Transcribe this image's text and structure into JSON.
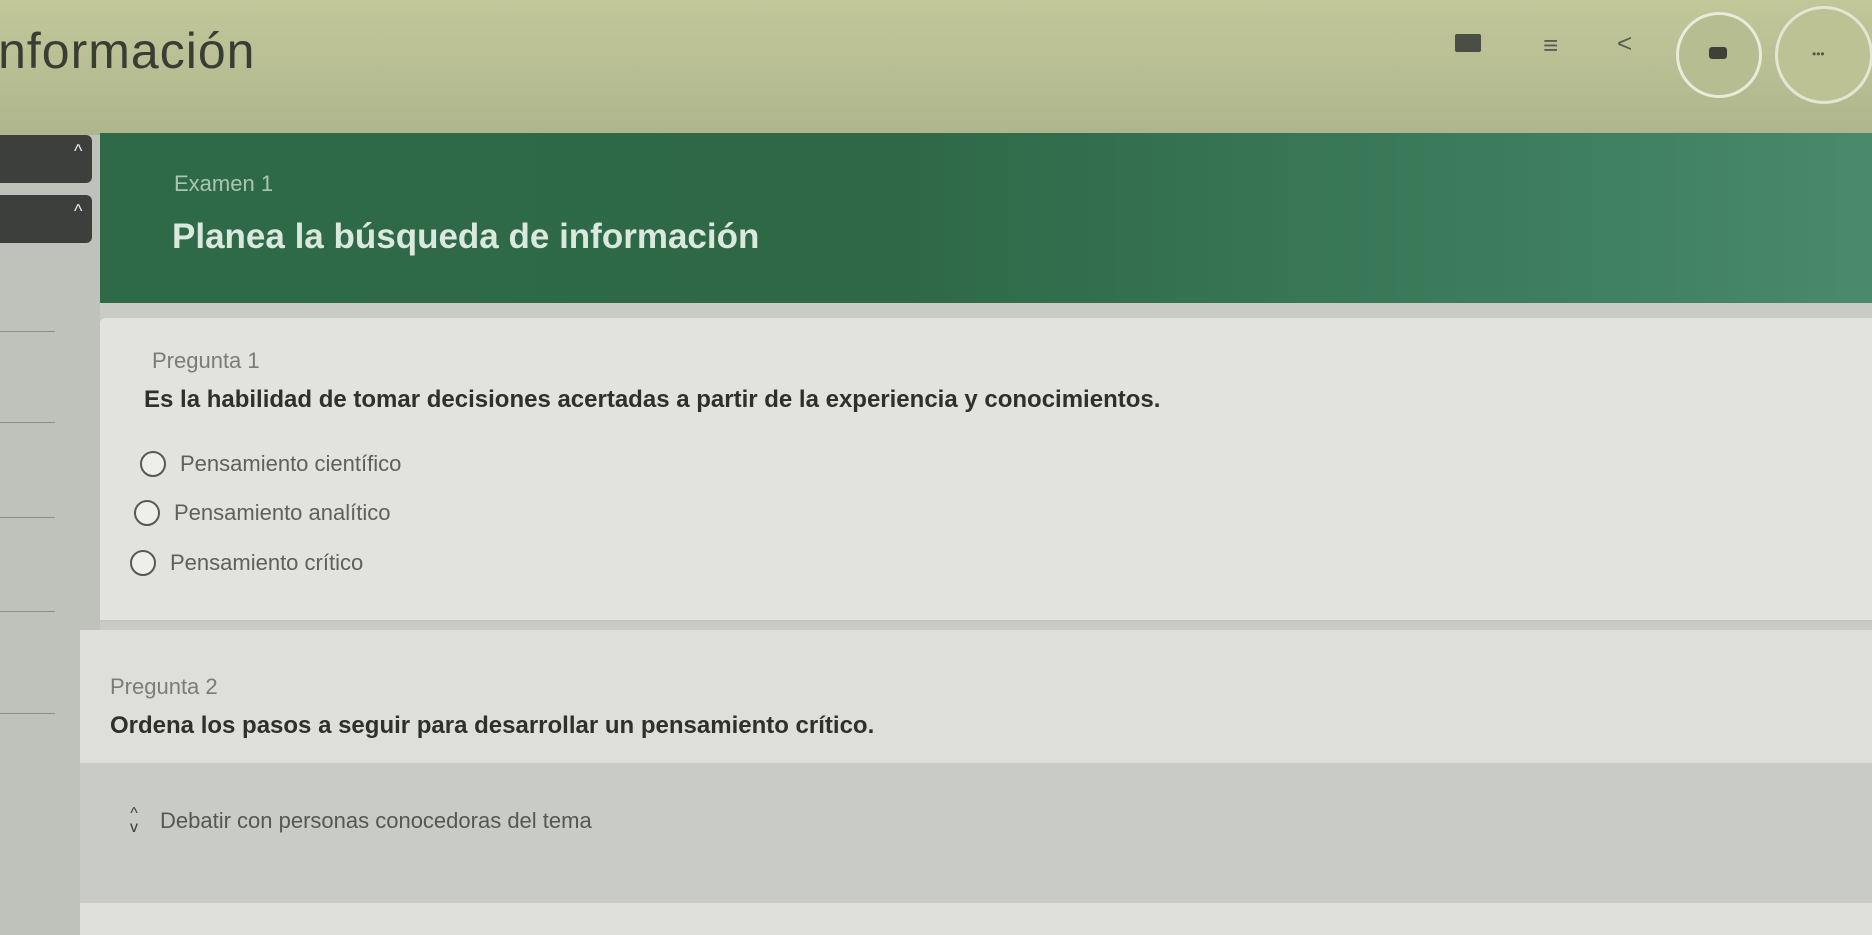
{
  "header": {
    "app_title": "información",
    "icons": [
      "grid-icon",
      "menu-icon",
      "share-icon",
      "profile-icon",
      "progress-icon"
    ]
  },
  "banner": {
    "exam_label": "Examen 1",
    "title": "Planea la búsqueda de información"
  },
  "question1": {
    "label": "Pregunta 1",
    "text": "Es la habilidad de tomar decisiones acertadas a partir de la experiencia y conocimientos.",
    "options": [
      "Pensamiento científico",
      "Pensamiento analítico",
      "Pensamiento crítico"
    ]
  },
  "question2": {
    "label": "Pregunta 2",
    "text": "Ordena los pasos a seguir para desarrollar un pensamiento crítico.",
    "items": [
      "Debatir con personas conocedoras del tema"
    ]
  },
  "colors": {
    "banner": "#2f6a48",
    "topbar": "#bcc294"
  }
}
